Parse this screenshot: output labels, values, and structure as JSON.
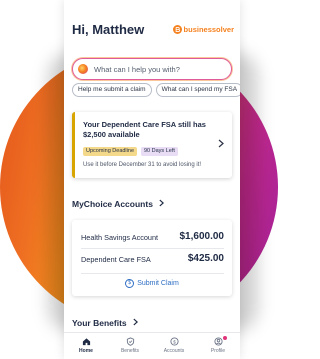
{
  "header": {
    "greeting": "Hi, Matthew",
    "brand_name": "businessolver",
    "brand_icon": "brand-logo-icon"
  },
  "search": {
    "placeholder": "What can I help you with?"
  },
  "chips": [
    {
      "label": "Help me submit a claim"
    },
    {
      "label": "What can I spend my FSA"
    }
  ],
  "alert": {
    "title": "Your Dependent Care FSA still has $2,500 available",
    "badge_deadline": "Upcoming Deadline",
    "badge_days": "90 Days Left",
    "note": "Use it before December 31 to avoid losing it!"
  },
  "mychoice": {
    "title": "MyChoice Accounts",
    "accounts": [
      {
        "name": "Health Savings Account",
        "amount": "$1,600.00"
      },
      {
        "name": "Dependent Care FSA",
        "amount": "$425.00"
      }
    ],
    "submit_label": "Submit Claim"
  },
  "benefits": {
    "title": "Your Benefits"
  },
  "tabbar": {
    "items": [
      {
        "label": "Home",
        "icon": "home-icon"
      },
      {
        "label": "Benefits",
        "icon": "shield-icon"
      },
      {
        "label": "Accounts",
        "icon": "dollar-icon"
      },
      {
        "label": "Profile",
        "icon": "user-icon"
      }
    ]
  },
  "colors": {
    "brand_orange": "#f58220",
    "navy_text": "#1f2a44",
    "link_blue": "#2f6fc4",
    "alert_accent": "#d8a400"
  }
}
